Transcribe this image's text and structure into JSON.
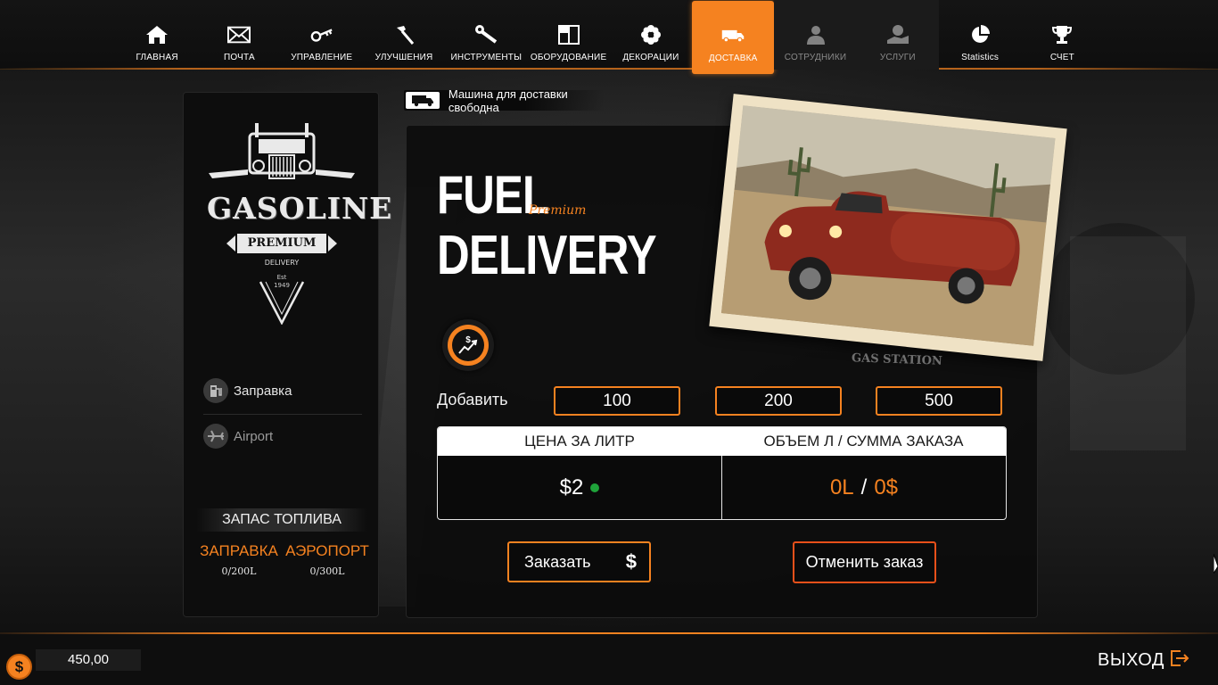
{
  "colors": {
    "accent": "#f58220",
    "cancel": "#e8501a",
    "status_ok": "#1fa33a"
  },
  "nav": {
    "items": [
      {
        "label": "ГЛАВНАЯ",
        "icon": "home-icon",
        "state": "normal"
      },
      {
        "label": "ПОЧТА",
        "icon": "mail-icon",
        "state": "normal"
      },
      {
        "label": "УПРАВЛЕНИЕ",
        "icon": "key-icon",
        "state": "normal"
      },
      {
        "label": "УЛУЧШЕНИЯ",
        "icon": "hammer-icon",
        "state": "normal"
      },
      {
        "label": "ИНСТРУМЕНТЫ",
        "icon": "wrench-icon",
        "state": "normal"
      },
      {
        "label": "ОБОРУДОВАНИЕ",
        "icon": "cabinet-icon",
        "state": "normal"
      },
      {
        "label": "ДЕКОРАЦИИ",
        "icon": "flower-icon",
        "state": "normal"
      },
      {
        "label": "ДОСТАВКА",
        "icon": "truck-icon",
        "state": "active"
      },
      {
        "label": "СОТРУДНИКИ",
        "icon": "worker-icon",
        "state": "disabled"
      },
      {
        "label": "УСЛУГИ",
        "icon": "service-icon",
        "state": "disabled"
      },
      {
        "label": "Statistics",
        "icon": "pie-chart-icon",
        "state": "normal"
      },
      {
        "label": "СЧЕТ",
        "icon": "trophy-icon",
        "state": "normal"
      }
    ]
  },
  "logo": {
    "name": "GASOLINE",
    "banner": "PREMIUM",
    "sub": "DELIVERY",
    "est": "Est",
    "year": "1949"
  },
  "locations": [
    {
      "label": "Заправка",
      "icon": "gas-station-icon"
    },
    {
      "label": "Airport",
      "icon": "airplane-icon"
    }
  ],
  "stock": {
    "title": "ЗАПАС ТОПЛИВА",
    "station": {
      "name": "ЗАПРАВКА",
      "value": "0/200L"
    },
    "airport": {
      "name": "АЭРОПОРТ",
      "value": "0/300L"
    }
  },
  "status": {
    "text": "Машина для доставки свободна"
  },
  "title": {
    "line1": "FUEL",
    "premium": "Premium",
    "line2": "DELIVERY"
  },
  "photo": {
    "caption": "GAS STATION"
  },
  "add": {
    "label": "Добавить",
    "options": [
      "100",
      "200",
      "500"
    ]
  },
  "price_table": {
    "col1_header": "ЦЕНА ЗА ЛИТР",
    "col2_header": "ОБЪЕМ Л / СУММА ЗАКАЗА",
    "price": "$2",
    "volume": "0L",
    "separator": "/",
    "sum": "0$"
  },
  "actions": {
    "order_label": "Заказать",
    "order_symbol": "$",
    "cancel_label": "Отменить заказ"
  },
  "footer": {
    "coin_symbol": "$",
    "balance": "450,00",
    "exit_label": "ВЫХОД"
  }
}
